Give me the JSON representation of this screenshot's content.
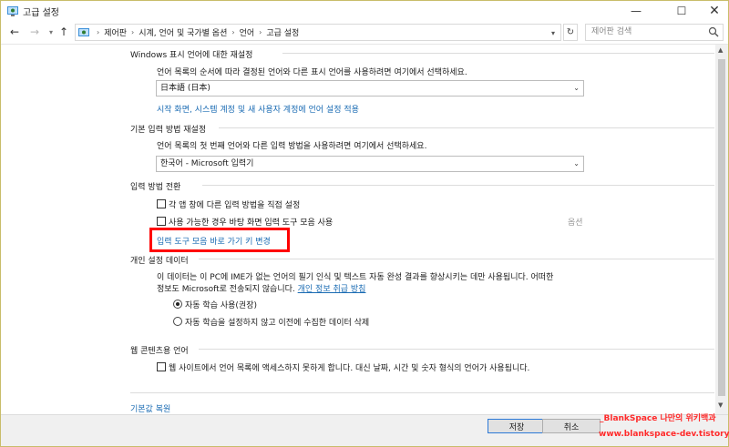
{
  "window": {
    "title": "고급 설정",
    "minimize_glyph": "—",
    "maximize_glyph": "☐",
    "close_glyph": "✕"
  },
  "address": {
    "breadcrumb": [
      "제어판",
      "시계, 언어 및 국가별 옵션",
      "언어",
      "고급 설정"
    ],
    "search_placeholder": "제어판 검색"
  },
  "display_language": {
    "heading": "Windows 표시 언어에 대한 재설정",
    "description": "언어 목록의 순서에 따라 결정된 언어와 다른 표시 언어를 사용하려면 여기에서 선택하세요.",
    "selected": "日本語 (日本)",
    "apply_link": "시작 화면, 시스템 계정 및 새 사용자 계정에 언어 설정 적용"
  },
  "input_method": {
    "heading": "기본 입력 방법 재설정",
    "description": "언어 목록의 첫 번째 언어와 다른 입력 방법을 사용하려면 여기에서 선택하세요.",
    "selected": "한국어 - Microsoft 입력기"
  },
  "switching": {
    "heading": "입력 방법 전환",
    "per_app_label": "각 앱 창에 다른 입력 방법을 직접 설정",
    "per_app_checked": false,
    "desktop_bar_label": "사용 가능한 경우 바탕 화면 입력 도구 모음 사용",
    "desktop_bar_checked": false,
    "options_label": "옵션",
    "hotkey_link": "입력 도구 모음 바로 가기 키 변경"
  },
  "personalization": {
    "heading": "개인 설정 데이터",
    "line1": "이 데이터는 이 PC에 IME가 없는 언어의 필기 인식 및 텍스트 자동 완성 결과를 향상시키는 데만 사용됩니다. 어떠한",
    "line2_prefix": "정보도 Microsoft로 전송되지 않습니다.",
    "privacy_link": "개인 정보 취급 방침",
    "radio_auto": "자동 학습 사용(권장)",
    "radio_off": "자동 학습을 설정하지 않고 이전에 수집한 데이터 삭제",
    "selected_option": "자동 학습 사용(권장)"
  },
  "web_content": {
    "heading": "웹 콘텐츠용 언어",
    "checkbox_label": "웹 사이트에서 언어 목록에 액세스하지 못하게 합니다. 대신 날짜, 시간 및 숫자 형식의 언어가 사용됩니다.",
    "checked": false
  },
  "restore_link": "기본값 복원",
  "footer": {
    "save": "저장",
    "cancel": "취소"
  },
  "watermark": {
    "line1": "_BlankSpace 나만의 위키백과",
    "line2": "www.blankspace-dev.tistory.com"
  },
  "colors": {
    "link": "#1a6bb3",
    "highlight": "#ff0000",
    "watermark": "#ff2a2a"
  }
}
